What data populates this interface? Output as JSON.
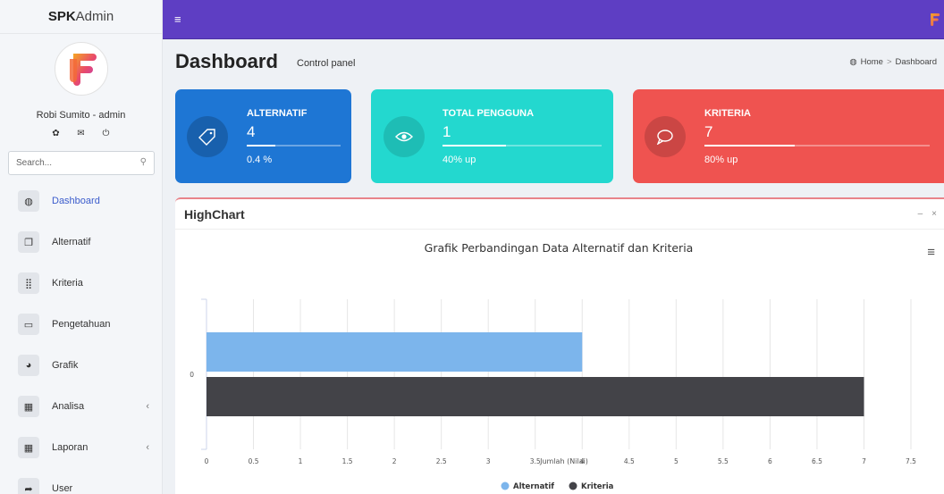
{
  "brand": {
    "bold": "SPK",
    "light": "Admin"
  },
  "user": {
    "name": "Robi Sumito - admin",
    "icons": [
      "gear-icon",
      "envelope-icon",
      "power-icon"
    ]
  },
  "search": {
    "placeholder": "Search..."
  },
  "menu": [
    {
      "label": "Dashboard",
      "icon": "dashboard-icon",
      "active": true
    },
    {
      "label": "Alternatif",
      "icon": "copy-icon"
    },
    {
      "label": "Kriteria",
      "icon": "grid-icon"
    },
    {
      "label": "Pengetahuan",
      "icon": "laptop-icon"
    },
    {
      "label": "Grafik",
      "icon": "pie-icon"
    },
    {
      "label": "Analisa",
      "icon": "table-icon",
      "arrow": "‹"
    },
    {
      "label": "Laporan",
      "icon": "table-icon",
      "arrow": "‹"
    },
    {
      "label": "User",
      "icon": "share-icon"
    }
  ],
  "header": {
    "title": "Dashboard",
    "subtitle": "Control panel",
    "breadcrumb_home": "Home",
    "breadcrumb_sep": ">",
    "breadcrumb_current": "Dashboard"
  },
  "cards": [
    {
      "title": "ALTERNATIF",
      "value": "4",
      "desc": "0.4 %",
      "progress": 0.3,
      "color": "#1e76d4",
      "icon": "tag-icon"
    },
    {
      "title": "TOTAL PENGGUNA",
      "value": "1",
      "desc": "40% up",
      "progress": 0.4,
      "color": "#23d8cf",
      "icon": "eye-icon"
    },
    {
      "title": "KRITERIA",
      "value": "7",
      "desc": "80% up",
      "progress": 0.4,
      "color": "#ef5350",
      "icon": "comment-icon"
    }
  ],
  "panel": {
    "title": "HighChart",
    "minimize": "–",
    "close": "×"
  },
  "chart_data": {
    "type": "bar",
    "orientation": "horizontal",
    "title": "Grafik Perbandingan Data Alternatif dan Kriteria",
    "xlabel": "Jumlah (Nilai)",
    "categories": [
      "0"
    ],
    "series": [
      {
        "name": "Alternatif",
        "values": [
          4
        ],
        "color": "#7cb5ec"
      },
      {
        "name": "Kriteria",
        "values": [
          7
        ],
        "color": "#434348"
      }
    ],
    "xlim": [
      0,
      7.5
    ],
    "ticks": [
      "0",
      "0.5",
      "1",
      "1.5",
      "2",
      "2.5",
      "3",
      "3.5",
      "4",
      "4.5",
      "5",
      "5.5",
      "6",
      "6.5",
      "7",
      "7.5"
    ],
    "grid": true,
    "legend": "bottom-center"
  }
}
